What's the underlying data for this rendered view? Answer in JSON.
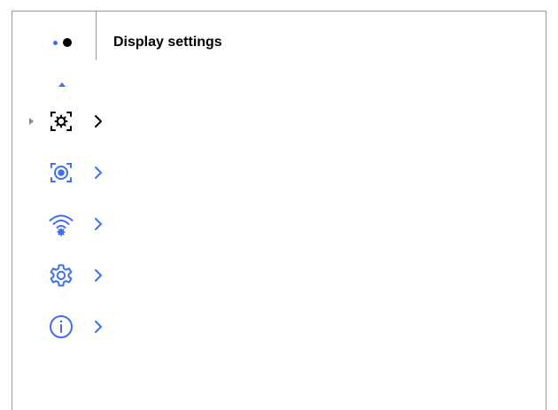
{
  "header": {
    "title": "Display settings",
    "page_indicator": {
      "pages": 2,
      "current": 2
    }
  },
  "colors": {
    "accent": "#3e6ef4",
    "active": "#000000",
    "pointer": "#8a8a8a",
    "border": "#9a9a9a"
  },
  "menu": {
    "scroll_up_icon": "triangle-up-icon",
    "items": [
      {
        "icon": "display-settings-icon",
        "selected": true
      },
      {
        "icon": "capture-focus-icon",
        "selected": false
      },
      {
        "icon": "wifi-settings-icon",
        "selected": false
      },
      {
        "icon": "gear-icon",
        "selected": false
      },
      {
        "icon": "info-icon",
        "selected": false
      }
    ]
  }
}
